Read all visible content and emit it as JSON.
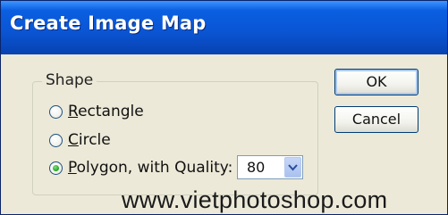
{
  "window": {
    "title": "Create Image Map"
  },
  "shape_group": {
    "legend": "Shape",
    "options": [
      {
        "label_pre": "",
        "label_u": "R",
        "label_post": "ectangle",
        "checked": false
      },
      {
        "label_pre": "",
        "label_u": "C",
        "label_post": "ircle",
        "checked": false
      },
      {
        "label_pre": "",
        "label_u": "P",
        "label_post": "olygon, with Quality:",
        "checked": true
      }
    ],
    "quality": {
      "value": "80"
    }
  },
  "buttons": {
    "ok": "OK",
    "cancel": "Cancel"
  },
  "watermark": "www.vietphotoshop.com",
  "colors": {
    "titlebar": "#0a56d6",
    "dialog_bg": "#ece9d8",
    "button_border": "#003c74",
    "radio_dot": "#21a121"
  }
}
